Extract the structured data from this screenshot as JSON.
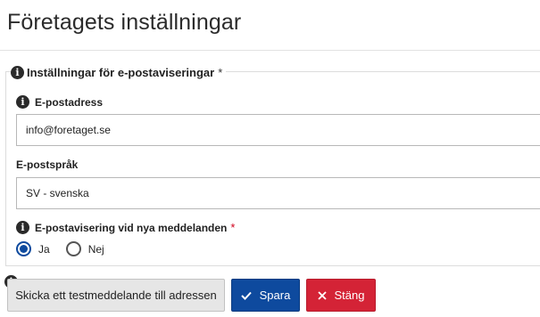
{
  "page": {
    "title": "Företagets inställningar"
  },
  "panel": {
    "legend": "Inställningar för e-postaviseringar",
    "legend_marker": "*"
  },
  "fields": {
    "email": {
      "label": "E-postadress",
      "value": "info@foretaget.se"
    },
    "language": {
      "label": "E-postspråk",
      "value": "SV - svenska"
    },
    "notify": {
      "label": "E-postavisering vid nya meddelanden",
      "required_marker": "*",
      "options": [
        {
          "label": "Ja",
          "checked": true
        },
        {
          "label": "Nej",
          "checked": false
        }
      ]
    }
  },
  "buttons": {
    "test": "Skicka ett testmeddelande till adressen",
    "save": "Spara",
    "close": "Stäng"
  },
  "colors": {
    "primary": "#0e4a9e",
    "danger": "#d42336",
    "required": "#d0021b"
  },
  "icons": {
    "info": "info-circle-icon",
    "save": "check-icon",
    "close": "close-icon"
  }
}
